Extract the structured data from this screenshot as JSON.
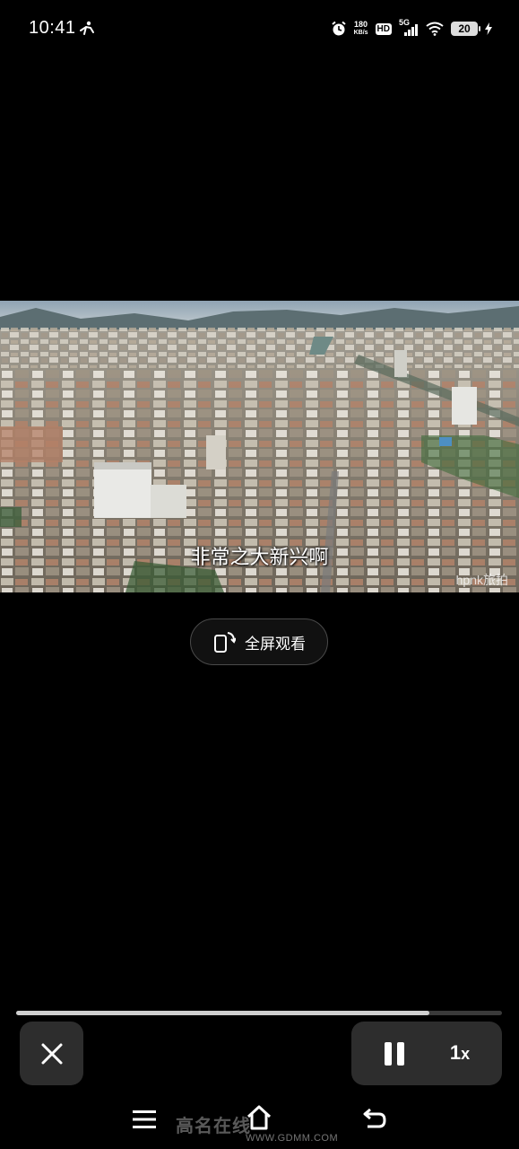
{
  "status_bar": {
    "time": "10:41",
    "network_speed_value": "180",
    "network_speed_unit": "KB/s",
    "hd_label": "HD",
    "signal_label": "5G",
    "battery_level": "20",
    "icons": [
      "person-icon",
      "alarm-icon",
      "hd-icon",
      "signal-icon",
      "wifi-icon",
      "battery-icon",
      "charging-icon"
    ]
  },
  "video": {
    "subtitle": "非常之大新兴啊",
    "watermark": "hpnk旅拍"
  },
  "fullscreen_button": {
    "label": "全屏观看",
    "icon": "rotate-screen-icon"
  },
  "playback": {
    "progress_fraction": 0.85,
    "speed_value": "1",
    "speed_unit": "x",
    "close_icon": "close-icon",
    "pause_icon": "pause-icon"
  },
  "nav_bar": {
    "icons": [
      "menu-icon",
      "home-icon",
      "back-icon"
    ],
    "overlay_watermark": "高名在线",
    "overlay_watermark_url": "WWW.GDMM.COM"
  },
  "colors": {
    "background": "#000000",
    "control_bg": "#2d2d2d",
    "progress_fill": "#cfcfcf",
    "progress_track": "#3a3a3a"
  }
}
